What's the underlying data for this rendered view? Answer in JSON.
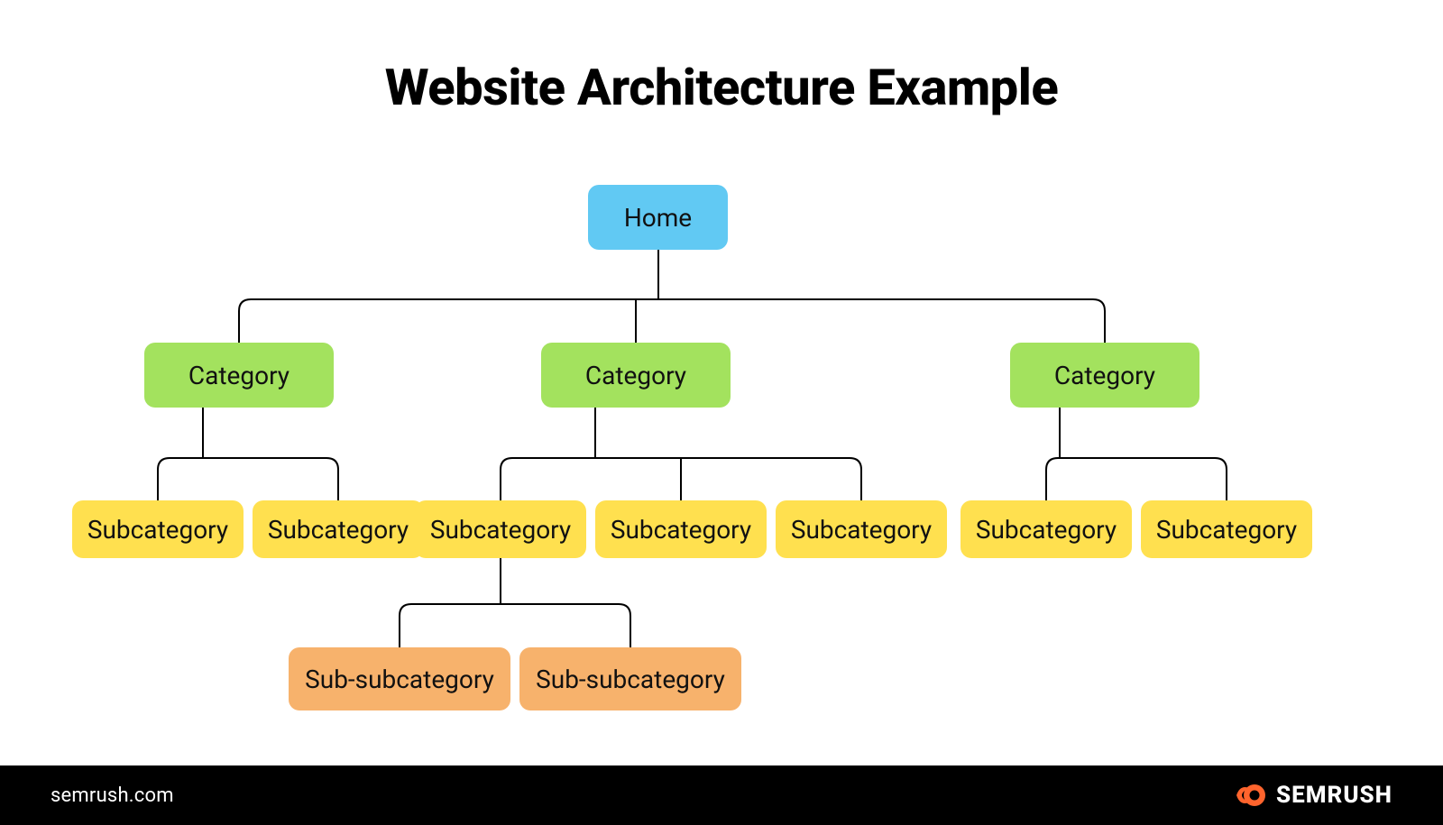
{
  "title": "Website Architecture Example",
  "nodes": {
    "home": "Home",
    "categories": [
      "Category",
      "Category",
      "Category"
    ],
    "subcategories": [
      "Subcategory",
      "Subcategory",
      "Subcategory",
      "Subcategory",
      "Subcategory",
      "Subcategory",
      "Subcategory"
    ],
    "subsubcategories": [
      "Sub-subcategory",
      "Sub-subcategory"
    ]
  },
  "colors": {
    "home": "#61c9f3",
    "category": "#a3e25e",
    "subcategory": "#ffe04f",
    "subsubcategory": "#f7b26c",
    "accent": "#ff642d"
  },
  "footer": {
    "url": "semrush.com",
    "brand": "SEMRUSH"
  }
}
